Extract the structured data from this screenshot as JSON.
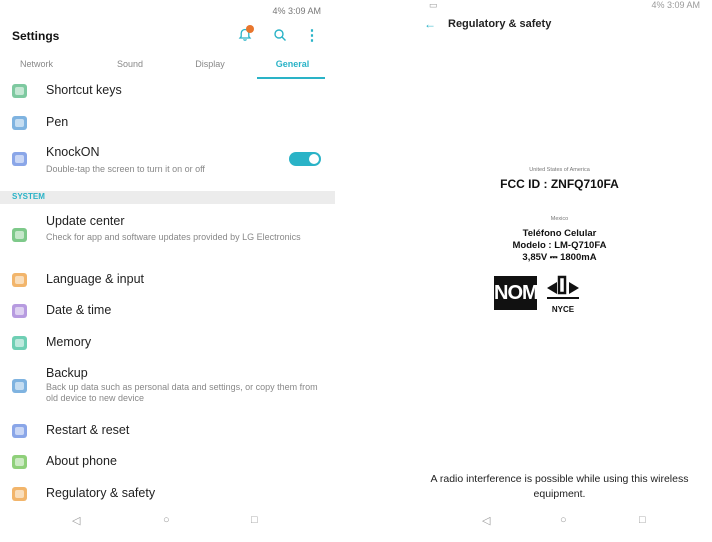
{
  "left": {
    "status": "4% 3:09 AM",
    "title": "Settings",
    "tabs": [
      "Network",
      "Sound",
      "Display",
      "General"
    ],
    "items": [
      {
        "title": "Shortcut keys",
        "icon": "shortcut-keys-icon",
        "color": "#7ec9a0"
      },
      {
        "title": "Pen",
        "icon": "pen-icon",
        "color": "#7fb3e0"
      },
      {
        "title": "KnockON",
        "subtitle": "Double-tap the screen to turn it on or off",
        "icon": "knockon-icon",
        "color": "#8aa6e8"
      },
      {
        "title": "Update center",
        "subtitle": "Check for app and software updates provided by LG Electronics",
        "icon": "update-center-icon",
        "color": "#7ec98a"
      },
      {
        "title": "Language & input",
        "icon": "language-icon",
        "color": "#f2b56b"
      },
      {
        "title": "Date & time",
        "icon": "date-time-icon",
        "color": "#b79be0"
      },
      {
        "title": "Memory",
        "icon": "memory-icon",
        "color": "#6fcfb4"
      },
      {
        "title": "Backup",
        "subtitle": "Back up data such as personal data and settings, or copy them from old device to new device",
        "icon": "backup-icon",
        "color": "#7fb3e0"
      },
      {
        "title": "Restart & reset",
        "icon": "restart-icon",
        "color": "#8aa6e8"
      },
      {
        "title": "About phone",
        "icon": "about-phone-icon",
        "color": "#8fd07a"
      },
      {
        "title": "Regulatory & safety",
        "icon": "regulatory-icon",
        "color": "#f2b56b"
      }
    ],
    "section": "SYSTEM",
    "knockon_enabled": true,
    "accent": "#2ab3c7"
  },
  "right": {
    "status": "4% 3:09 AM",
    "title": "Regulatory & safety",
    "usa_label": "United States of America",
    "fcc": "FCC ID : ZNFQ710FA",
    "mexico_label": "Mexico",
    "mx_line1": "Teléfono Celular",
    "mx_line2": "Modelo : LM-Q710FA",
    "mx_line3": "3,85V ⎓ 1800mA",
    "nom": "NOM",
    "nyce": "NYCE",
    "footer": "A radio interference is possible while using this wireless equipment."
  }
}
